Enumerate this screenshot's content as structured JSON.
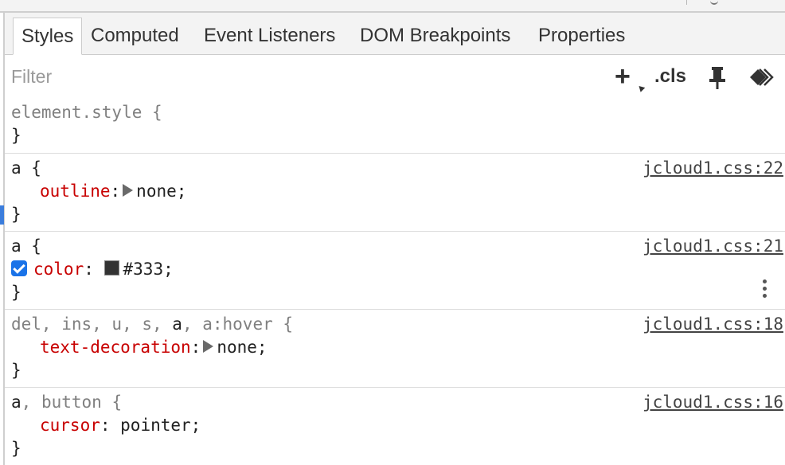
{
  "tabs": [
    "Styles",
    "Computed",
    "Event Listeners",
    "DOM Breakpoints",
    "Properties"
  ],
  "active_tab": "Styles",
  "filter": {
    "placeholder": "Filter",
    "value": ""
  },
  "toolbar": {
    "new_rule_label": "+",
    "cls_label": ".cls",
    "icons": [
      "new-style-rule-icon",
      "pin-icon",
      "rendering-icon"
    ]
  },
  "rules": [
    {
      "selector": "element.style {",
      "closing": "}",
      "source": "",
      "props": []
    },
    {
      "selector": "a {",
      "closing": "}",
      "source": "jcloud1.css:22",
      "props": [
        {
          "name": "outline",
          "colon": ":",
          "value": "none;",
          "has_expander": true
        }
      ]
    },
    {
      "selector": "a {",
      "closing": "}",
      "source": "jcloud1.css:21",
      "props": [
        {
          "name": "color",
          "colon": ": ",
          "value": "#333;",
          "checked": true,
          "swatch_color": "#333333"
        }
      ]
    },
    {
      "selector_parts": [
        "del, ins, u, s, ",
        "a",
        ", a:hover {"
      ],
      "closing": "}",
      "source": "jcloud1.css:18",
      "props": [
        {
          "name": "text-decoration",
          "colon": ":",
          "value": "none;",
          "has_expander": true
        }
      ]
    },
    {
      "selector_parts": [
        "a",
        ", button {"
      ],
      "closing": "}",
      "source": "jcloud1.css:16",
      "props": [
        {
          "name": "cursor",
          "colon": ": ",
          "value": "pointer;"
        }
      ]
    }
  ]
}
